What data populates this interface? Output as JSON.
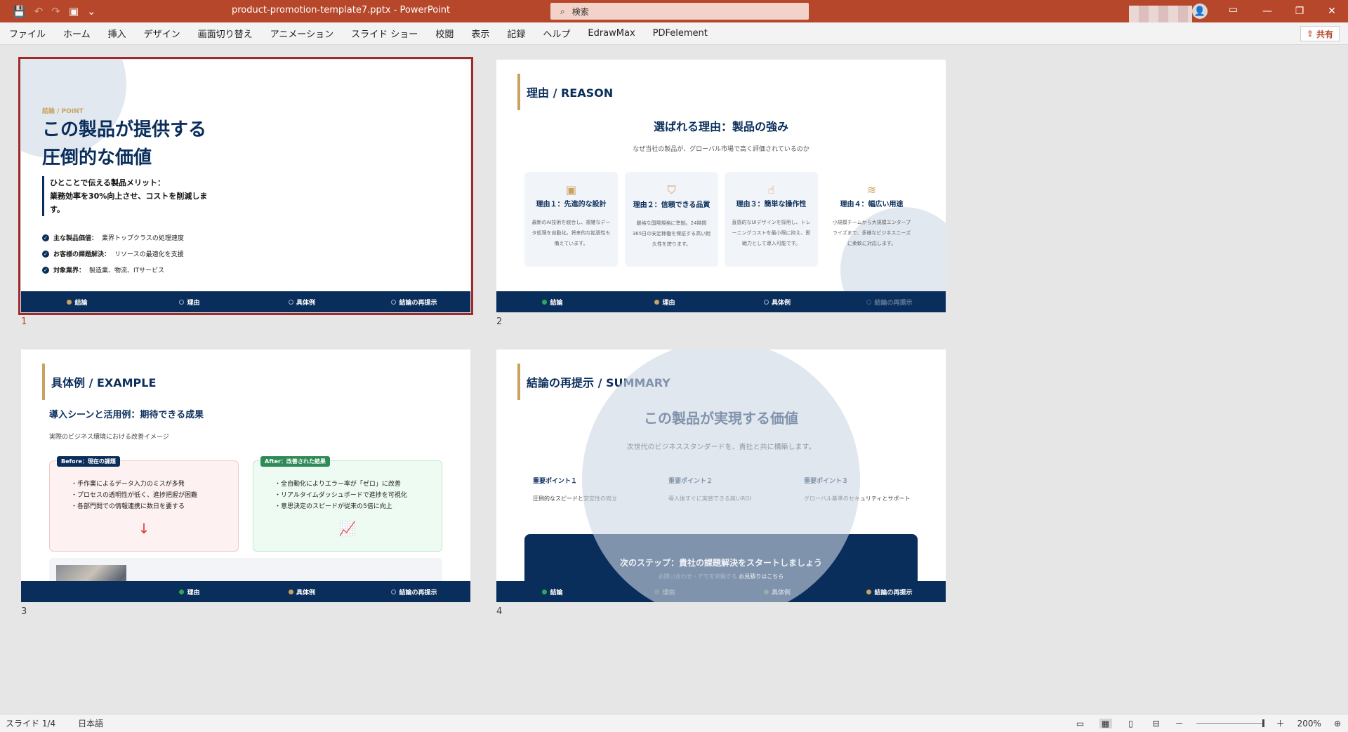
{
  "app": {
    "file_name": "product-promotion-template7.pptx",
    "app_name": "PowerPoint",
    "title_sep": " - ",
    "search_placeholder": "検索",
    "share_label": "共有"
  },
  "menu": [
    "ファイル",
    "ホーム",
    "挿入",
    "デザイン",
    "画面切り替え",
    "アニメーション",
    "スライド ショー",
    "校閲",
    "表示",
    "記録",
    "ヘルプ",
    "EdrawMax",
    "PDFelement"
  ],
  "nav_labels": [
    "結論",
    "理由",
    "具体例",
    "結論の再提示"
  ],
  "slide1": {
    "number": "1",
    "tag": "結論 / POINT",
    "headline_1": "この製品が提供する",
    "headline_2": "圧倒的な価値",
    "quote_1": "ひとことで伝える製品メリット：",
    "quote_2": "業務効率を30%向上させ、コストを削減しま",
    "quote_3": "す。",
    "points": [
      {
        "label": "主な製品価値：",
        "text": "業界トップクラスの処理速度"
      },
      {
        "label": "お客様の課題解決：",
        "text": "リソースの最適化を支援"
      },
      {
        "label": "対象業界：",
        "text": "製造業、物流、ITサービス"
      }
    ]
  },
  "slide2": {
    "number": "2",
    "section": "理由 / REASON",
    "title": "選ばれる理由：製品の強み",
    "subtitle": "なぜ当社の製品が、グローバル市場で高く評価されているのか",
    "cards": [
      {
        "icon": "chip-icon",
        "title": "理由１：先進的な設計",
        "desc": "最新のAI技術を統合し、複雑なデータ処理を自動化。将来的な拡張性も備えています。"
      },
      {
        "icon": "shield-icon",
        "title": "理由２：信頼できる品質",
        "desc": "厳格な国際規格に準拠。24時間365日の安定稼働を保証する高い耐久性を誇ります。"
      },
      {
        "icon": "hand-pointer-icon",
        "title": "理由３：簡単な操作性",
        "desc": "直感的なUIデザインを採用し、トレーニングコストを最小限に抑え、即戦力として導入可能です。"
      },
      {
        "icon": "layers-icon",
        "title": "理由４：幅広い用途",
        "desc": "小規模チームから大規模エンタープライズまで、多様なビジネスニーズに柔軟に対応します。"
      }
    ]
  },
  "slide3": {
    "number": "3",
    "section": "具体例 / EXAMPLE",
    "title": "導入シーンと活用例：期待できる成果",
    "subtitle": "実際のビジネス環境における改善イメージ",
    "before": {
      "label": "Before：現在の課題",
      "items": [
        "・手作業によるデータ入力のミスが多発",
        "・プロセスの透明性が低く、進捗把握が困難",
        "・各部門間での情報連携に数日を要する"
      ]
    },
    "after": {
      "label": "After：改善された結果",
      "items": [
        "・全自動化によりエラー率が「ゼロ」に改善",
        "・リアルタイムダッシュボードで進捗を可視化",
        "・意思決定のスピードが従来の5倍に向上"
      ]
    }
  },
  "slide4": {
    "number": "4",
    "section": "結論の再提示 / SUMMARY",
    "title": "この製品が実現する価値",
    "subtitle": "次世代のビジネススタンダードを、貴社と共に構築します。",
    "points": [
      {
        "title": "重要ポイント１",
        "desc": "圧倒的なスピードと安定性の両立"
      },
      {
        "title": "重要ポイント２",
        "desc": "導入後すぐに実感できる高いROI"
      },
      {
        "title": "重要ポイント３",
        "desc": "グローバル基準のセキュリティとサポート"
      }
    ],
    "cta_title": "次のステップ：貴社の課題解決をスタートしましょう",
    "cta_sub_faded": "お問い合わせ・デモを依頼する",
    "cta_sub": "お見積りはこちら"
  },
  "status": {
    "slide_info": "スライド 1/4",
    "language": "日本語",
    "zoom_minus": "－",
    "zoom_plus": "＋",
    "zoom": "200%"
  },
  "colors": {
    "titlebar": "#b7472a",
    "navy": "#0a2e5c",
    "gold": "#c9a261",
    "green": "#2ea85a"
  }
}
